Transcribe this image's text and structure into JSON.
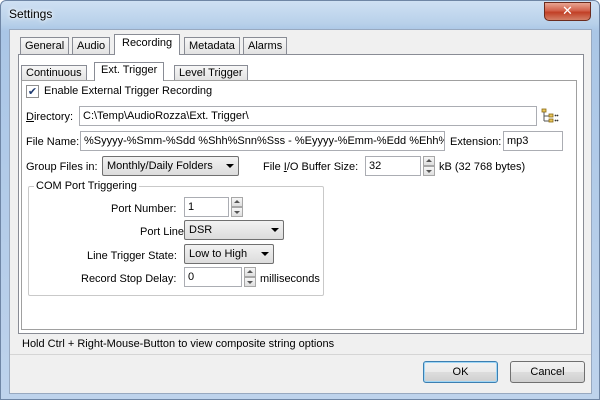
{
  "window": {
    "title": "Settings",
    "close_glyph": "✕"
  },
  "tabs": [
    "General",
    "Audio",
    "Recording",
    "Metadata",
    "Alarms"
  ],
  "active_tab": "Recording",
  "subtabs": [
    "Continuous",
    "Ext. Trigger",
    "Level Trigger"
  ],
  "active_subtab": "Ext. Trigger",
  "enable_checkbox": {
    "label": "Enable External Trigger Recording",
    "checked": true,
    "check_glyph": "✔"
  },
  "directory": {
    "label_pre": "",
    "label_u": "D",
    "label_post": "irectory:",
    "value": "C:\\Temp\\AudioRozza\\Ext. Trigger\\",
    "icon": "folder-tree-icon"
  },
  "file_name": {
    "label": "File Name:",
    "value": "%Syyyy-%Smm-%Sdd %Shh%Snn%Sss - %Eyyyy-%Emm-%Edd %Ehh%E"
  },
  "extension": {
    "label": "Extension:",
    "value": "mp3"
  },
  "group_files": {
    "label": "Group Files in:",
    "value": "Monthly/Daily Folders"
  },
  "buffer": {
    "label_pre": "File ",
    "label_u": "I",
    "label_post": "/O Buffer Size:",
    "value": "32",
    "unit": "kB (32 768 bytes)"
  },
  "com_group": {
    "title": "COM Port Triggering",
    "port_number": {
      "label": "Port Number:",
      "value": "1"
    },
    "port_line": {
      "label": "Port Line:",
      "value": "DSR"
    },
    "line_state": {
      "label": "Line Trigger State:",
      "value": "Low to High"
    },
    "stop_delay": {
      "label": "Record Stop Delay:",
      "value": "0",
      "unit": "milliseconds"
    }
  },
  "hint": "Hold Ctrl + Right-Mouse-Button to view composite string options",
  "buttons": {
    "ok": "OK",
    "cancel": "Cancel"
  }
}
